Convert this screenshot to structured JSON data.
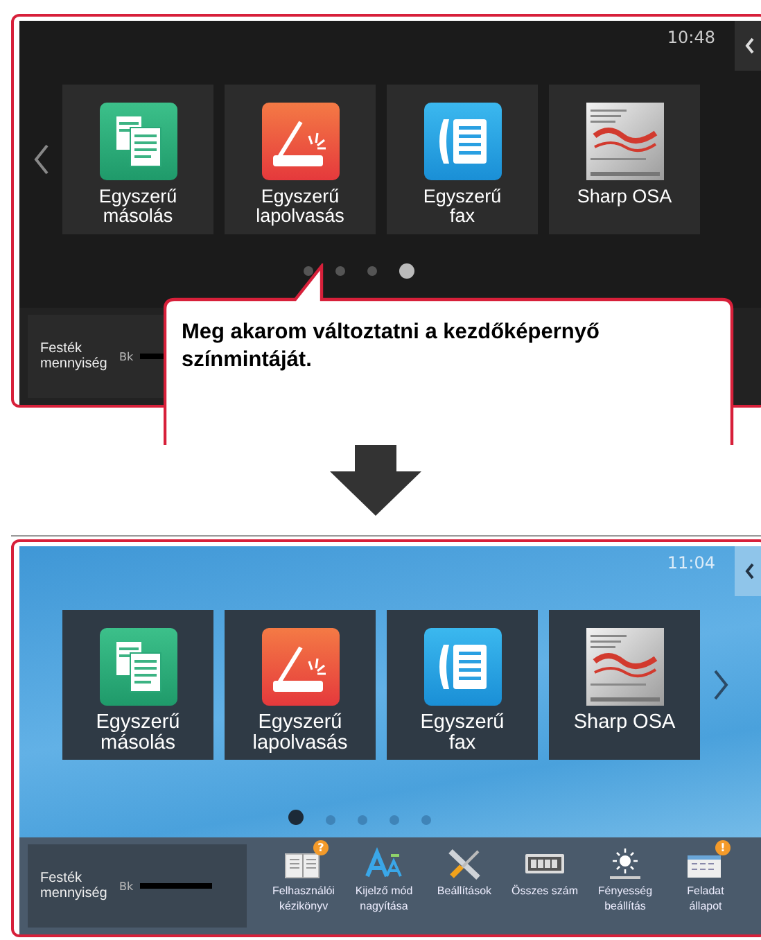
{
  "screens": [
    {
      "dark_theme": true,
      "time": "10:48",
      "prev_arrow": true,
      "next_arrow": false,
      "tiles": [
        {
          "label": "Egyszerű másolás"
        },
        {
          "label": "Egyszerű lapolvasás"
        },
        {
          "label": "Egyszerű fax"
        },
        {
          "label": "Sharp OSA"
        }
      ],
      "page_dots": [
        {
          "selected": false
        },
        {
          "selected": false
        },
        {
          "selected": false
        },
        {
          "selected": true
        }
      ],
      "toner": {
        "label": "Festék mennyiség",
        "color_code": "Bk"
      }
    },
    {
      "dark_theme": false,
      "time": "11:04",
      "prev_arrow": false,
      "next_arrow": true,
      "tiles": [
        {
          "label": "Egyszerű másolás"
        },
        {
          "label": "Egyszerű lapolvasás"
        },
        {
          "label": "Egyszerű fax"
        },
        {
          "label": "Sharp OSA"
        }
      ],
      "page_dots": [
        {
          "selected": true
        },
        {
          "selected": false
        },
        {
          "selected": false
        },
        {
          "selected": false
        },
        {
          "selected": false
        }
      ],
      "toner": {
        "label": "Festék mennyiség",
        "color_code": "Bk",
        "level": 1
      },
      "shortcuts": [
        {
          "label": "Felhasználói kézikönyv",
          "badge": "?"
        },
        {
          "label": "Kijelző mód nagyítása"
        },
        {
          "label": "Beállítások"
        },
        {
          "label": "Összes szám"
        },
        {
          "label": "Fényesség beállítás"
        },
        {
          "label": "Feladat állapot",
          "badge": "!"
        }
      ]
    }
  ],
  "callout": {
    "text": "Meg akarom változtatni a kezdőképernyő színmintáját."
  }
}
